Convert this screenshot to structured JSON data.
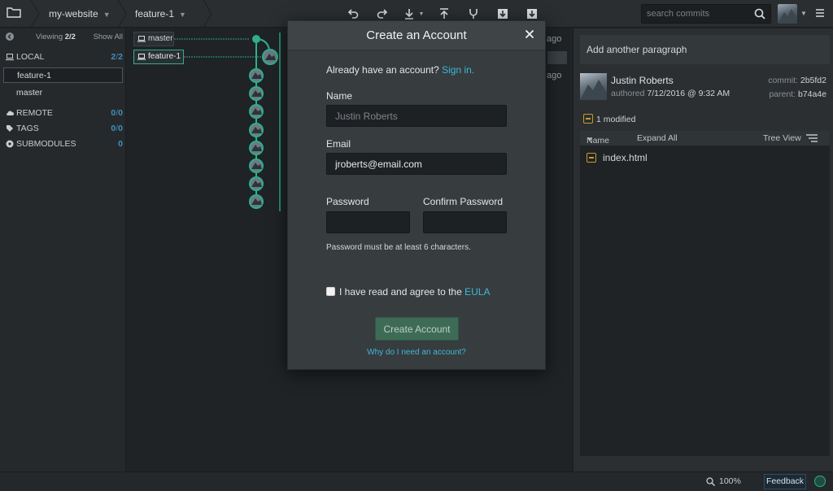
{
  "topbar": {
    "repo": "my-website",
    "branch": "feature-1",
    "search_placeholder": "search commits"
  },
  "leftpanel": {
    "viewing_label": "Viewing",
    "viewing_count": "2/2",
    "show_all": "Show All",
    "local": {
      "label": "LOCAL",
      "count": "2",
      "total": "2"
    },
    "branches": [
      "feature-1",
      "master"
    ],
    "remote": {
      "label": "REMOTE",
      "count": "0",
      "total": "0"
    },
    "tags": {
      "label": "TAGS",
      "count": "0",
      "total": "0"
    },
    "submodules": {
      "label": "SUBMODULES",
      "count": "0"
    }
  },
  "graph": {
    "branch_tags": [
      "master",
      "feature-1"
    ],
    "ago_labels": [
      "ago",
      "ago"
    ]
  },
  "rightpanel": {
    "paragraph": "Add another paragraph",
    "author": "Justin Roberts",
    "authored_label": "authored",
    "authored_date": "7/12/2016 @ 9:32 AM",
    "commit_label": "commit:",
    "commit": "2b5fd2",
    "parent_label": "parent:",
    "parent": "b74a4e",
    "modified": "1 modified",
    "col_name": "Name",
    "expand_all": "Expand All",
    "tree_view": "Tree View",
    "files": [
      "index.html"
    ]
  },
  "statusbar": {
    "zoom": "100%",
    "feedback": "Feedback"
  },
  "modal": {
    "title": "Create an Account",
    "have_account": "Already have an account?",
    "sign_in": "Sign in.",
    "name_label": "Name",
    "name_placeholder": "Justin Roberts",
    "email_label": "Email",
    "email_value": "jroberts@email.com",
    "password_label": "Password",
    "confirm_label": "Confirm Password",
    "password_hint": "Password must be at least 6 characters.",
    "eula_text": "I have read and agree to the",
    "eula_link": "EULA",
    "create_button": "Create Account",
    "why_link": "Why do I need an account?"
  },
  "colors": {
    "graph_teal": "#2fae8a",
    "link_blue": "#3fb8d6",
    "count_blue": "#3a92c7",
    "create_green": "#3e6b55"
  }
}
